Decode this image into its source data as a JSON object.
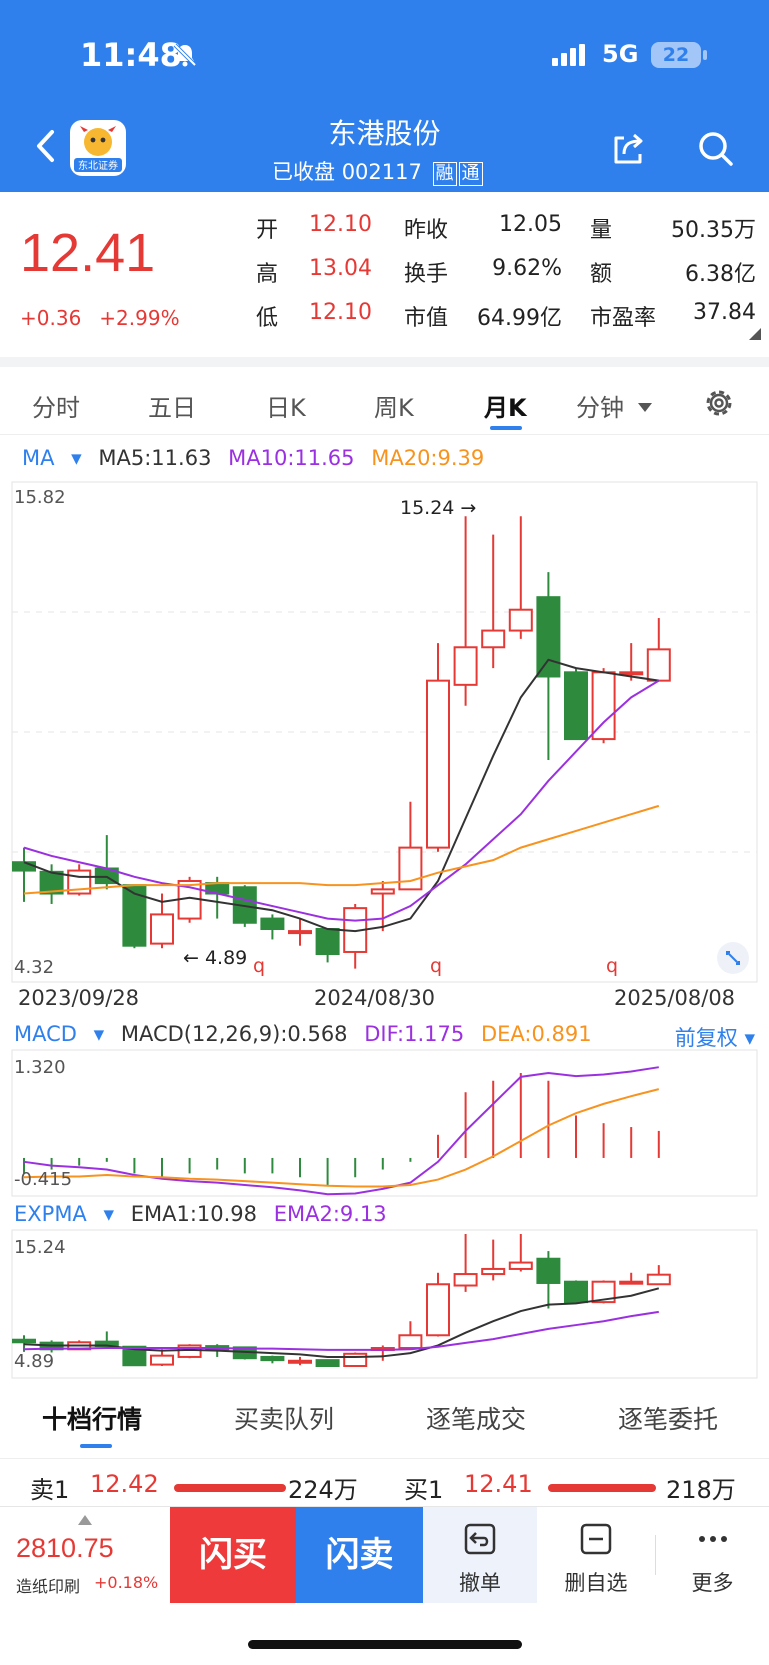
{
  "status_bar": {
    "time": "11:48",
    "network": "5G",
    "battery": "22"
  },
  "header": {
    "title": "东港股份",
    "status_text": "已收盘",
    "code": "002117",
    "tag_rong": "融",
    "tag_tong": "通",
    "logo_text": "东北证券"
  },
  "quote": {
    "price": "12.41",
    "change": "+0.36",
    "change_pct": "+2.99%",
    "rows": [
      {
        "l1": "开",
        "v1": "12.10",
        "l2": "昨收",
        "v2": "12.05",
        "l3": "量",
        "v3": "50.35万"
      },
      {
        "l1": "高",
        "v1": "13.04",
        "l2": "换手",
        "v2": "9.62%",
        "l3": "额",
        "v3": "6.38亿"
      },
      {
        "l1": "低",
        "v1": "12.10",
        "l2": "市值",
        "v2": "64.99亿",
        "l3": "市盈率",
        "v3": "37.84"
      }
    ]
  },
  "tabs": [
    "分时",
    "五日",
    "日K",
    "周K",
    "月K",
    "分钟"
  ],
  "active_tab": "月K",
  "ma_legend": {
    "selector": "MA",
    "ma5": "MA5:11.63",
    "ma10": "MA10:11.65",
    "ma20": "MA20:9.39"
  },
  "kline_labels": {
    "y_max": "15.82",
    "y_min": "4.32",
    "high_marker": "15.24 →",
    "low_marker": "← 4.89",
    "q_marks": [
      "q",
      "q",
      "q"
    ],
    "dates": [
      "2023/09/28",
      "2024/08/30",
      "2025/08/08"
    ]
  },
  "macd_legend": {
    "selector": "MACD",
    "macd": "MACD(12,26,9):0.568",
    "dif": "DIF:1.175",
    "dea": "DEA:0.891",
    "adjust": "前复权",
    "y_max": "1.320",
    "y_min": "-0.415"
  },
  "expma_legend": {
    "selector": "EXPMA",
    "ema1": "EMA1:10.98",
    "ema2": "EMA2:9.13",
    "y_max": "15.24",
    "y_min": "4.89"
  },
  "panel_tabs": [
    "十档行情",
    "买卖队列",
    "逐笔成交",
    "逐笔委托"
  ],
  "order_book": {
    "sell_label": "卖1",
    "sell_price": "12.42",
    "sell_volume": "224万",
    "buy_label": "买1",
    "buy_price": "12.41",
    "buy_volume": "218万"
  },
  "bottom_bar": {
    "index_value": "2810.75",
    "index_name": "造纸印刷",
    "index_change": "+0.18%",
    "flash_buy": "闪买",
    "flash_sell": "闪卖",
    "cancel": "撤单",
    "remove_watch": "删自选",
    "more": "更多"
  },
  "colors": {
    "up": "#e53935",
    "down": "#2e8b3e",
    "accent": "#2f80ed",
    "ma5": "#333333",
    "ma10": "#9b30e0",
    "ma20": "#f7931e"
  },
  "chart_data": [
    {
      "type": "candlestick",
      "title": "",
      "y_range": [
        4.32,
        15.82
      ],
      "x_labels": [
        "2023/09/28",
        "2024/08/30",
        "2025/08/08"
      ],
      "candles": [
        {
          "o": 6.95,
          "c": 6.75,
          "h": 7.3,
          "l": 6.0
        },
        {
          "o": 6.72,
          "c": 6.2,
          "h": 6.9,
          "l": 5.95
        },
        {
          "o": 6.2,
          "c": 6.75,
          "h": 6.9,
          "l": 6.15
        },
        {
          "o": 6.8,
          "c": 6.45,
          "h": 7.6,
          "l": 6.3
        },
        {
          "o": 6.4,
          "c": 4.95,
          "h": 6.4,
          "l": 4.89
        },
        {
          "o": 5.0,
          "c": 5.7,
          "h": 6.2,
          "l": 4.89
        },
        {
          "o": 5.6,
          "c": 6.5,
          "h": 6.6,
          "l": 5.5
        },
        {
          "o": 6.45,
          "c": 6.2,
          "h": 6.6,
          "l": 5.6
        },
        {
          "o": 6.35,
          "c": 5.5,
          "h": 6.4,
          "l": 5.4
        },
        {
          "o": 5.6,
          "c": 5.35,
          "h": 5.7,
          "l": 5.1
        },
        {
          "o": 5.3,
          "c": 5.3,
          "h": 5.6,
          "l": 4.95
        },
        {
          "o": 5.35,
          "c": 4.75,
          "h": 5.35,
          "l": 4.55
        },
        {
          "o": 4.8,
          "c": 5.85,
          "h": 5.95,
          "l": 4.4
        },
        {
          "o": 6.2,
          "c": 6.3,
          "h": 6.5,
          "l": 5.3
        },
        {
          "o": 6.3,
          "c": 7.3,
          "h": 8.4,
          "l": 6.3
        },
        {
          "o": 7.3,
          "c": 11.3,
          "h": 12.2,
          "l": 7.2
        },
        {
          "o": 11.2,
          "c": 12.1,
          "h": 15.24,
          "l": 10.7
        },
        {
          "o": 12.1,
          "c": 12.5,
          "h": 14.8,
          "l": 11.6
        },
        {
          "o": 12.5,
          "c": 13.0,
          "h": 15.24,
          "l": 12.3
        },
        {
          "o": 13.3,
          "c": 11.4,
          "h": 13.9,
          "l": 9.4
        },
        {
          "o": 11.5,
          "c": 9.9,
          "h": 11.6,
          "l": 9.9
        },
        {
          "o": 9.9,
          "c": 11.5,
          "h": 11.6,
          "l": 9.8
        },
        {
          "o": 11.5,
          "c": 11.5,
          "h": 12.2,
          "l": 11.3
        },
        {
          "o": 11.3,
          "c": 12.05,
          "h": 12.8,
          "l": 11.3
        }
      ],
      "series": [
        {
          "name": "MA5",
          "values": [
            6.95,
            6.7,
            6.6,
            6.6,
            6.2,
            6.0,
            6.1,
            6.0,
            5.9,
            5.8,
            5.6,
            5.35,
            5.3,
            5.4,
            5.6,
            6.5,
            8.0,
            9.5,
            10.9,
            11.8,
            11.6,
            11.5,
            11.4,
            11.3
          ]
        },
        {
          "name": "MA10",
          "values": [
            7.3,
            7.1,
            6.95,
            6.8,
            6.6,
            6.45,
            6.35,
            6.2,
            6.05,
            5.9,
            5.75,
            5.6,
            5.55,
            5.6,
            5.9,
            6.4,
            6.9,
            7.5,
            8.1,
            8.9,
            9.6,
            10.3,
            10.9,
            11.3
          ]
        },
        {
          "name": "MA20",
          "values": [
            6.2,
            6.25,
            6.3,
            6.35,
            6.4,
            6.4,
            6.4,
            6.45,
            6.45,
            6.45,
            6.45,
            6.4,
            6.4,
            6.45,
            6.5,
            6.7,
            6.85,
            7.0,
            7.3,
            7.5,
            7.7,
            7.9,
            8.1,
            8.3
          ]
        }
      ]
    },
    {
      "type": "bar",
      "title": "MACD",
      "y_range": [
        -0.415,
        1.32
      ],
      "bars": [
        -0.2,
        -0.15,
        -0.1,
        -0.05,
        -0.2,
        -0.25,
        -0.2,
        -0.15,
        -0.2,
        -0.2,
        -0.25,
        -0.35,
        -0.25,
        -0.15,
        -0.05,
        0.3,
        0.85,
        1.0,
        1.1,
        1.0,
        0.55,
        0.45,
        0.4,
        0.35
      ],
      "series": [
        {
          "name": "DIF",
          "values": [
            -0.05,
            -0.1,
            -0.12,
            -0.15,
            -0.22,
            -0.27,
            -0.3,
            -0.32,
            -0.35,
            -0.38,
            -0.42,
            -0.47,
            -0.46,
            -0.4,
            -0.32,
            -0.05,
            0.35,
            0.7,
            1.05,
            1.1,
            1.06,
            1.08,
            1.12,
            1.175
          ]
        },
        {
          "name": "DEA",
          "values": [
            -0.25,
            -0.24,
            -0.24,
            -0.22,
            -0.24,
            -0.25,
            -0.27,
            -0.28,
            -0.3,
            -0.32,
            -0.34,
            -0.36,
            -0.37,
            -0.37,
            -0.35,
            -0.28,
            -0.15,
            0.02,
            0.22,
            0.42,
            0.58,
            0.7,
            0.8,
            0.891
          ]
        }
      ]
    },
    {
      "type": "candlestick",
      "title": "EXPMA",
      "y_range": [
        4.89,
        15.24
      ],
      "series": [
        {
          "name": "EMA1",
          "values": [
            6.6,
            6.5,
            6.5,
            6.5,
            6.2,
            6.1,
            6.15,
            6.1,
            6.0,
            5.9,
            5.8,
            5.6,
            5.6,
            5.65,
            5.9,
            6.5,
            7.5,
            8.4,
            9.2,
            9.7,
            9.8,
            10.1,
            10.4,
            10.98
          ]
        },
        {
          "name": "EMA2",
          "values": [
            6.2,
            6.25,
            6.25,
            6.3,
            6.3,
            6.3,
            6.3,
            6.3,
            6.25,
            6.25,
            6.2,
            6.15,
            6.15,
            6.15,
            6.2,
            6.4,
            6.7,
            7.0,
            7.4,
            7.8,
            8.1,
            8.4,
            8.8,
            9.13
          ]
        }
      ]
    }
  ]
}
